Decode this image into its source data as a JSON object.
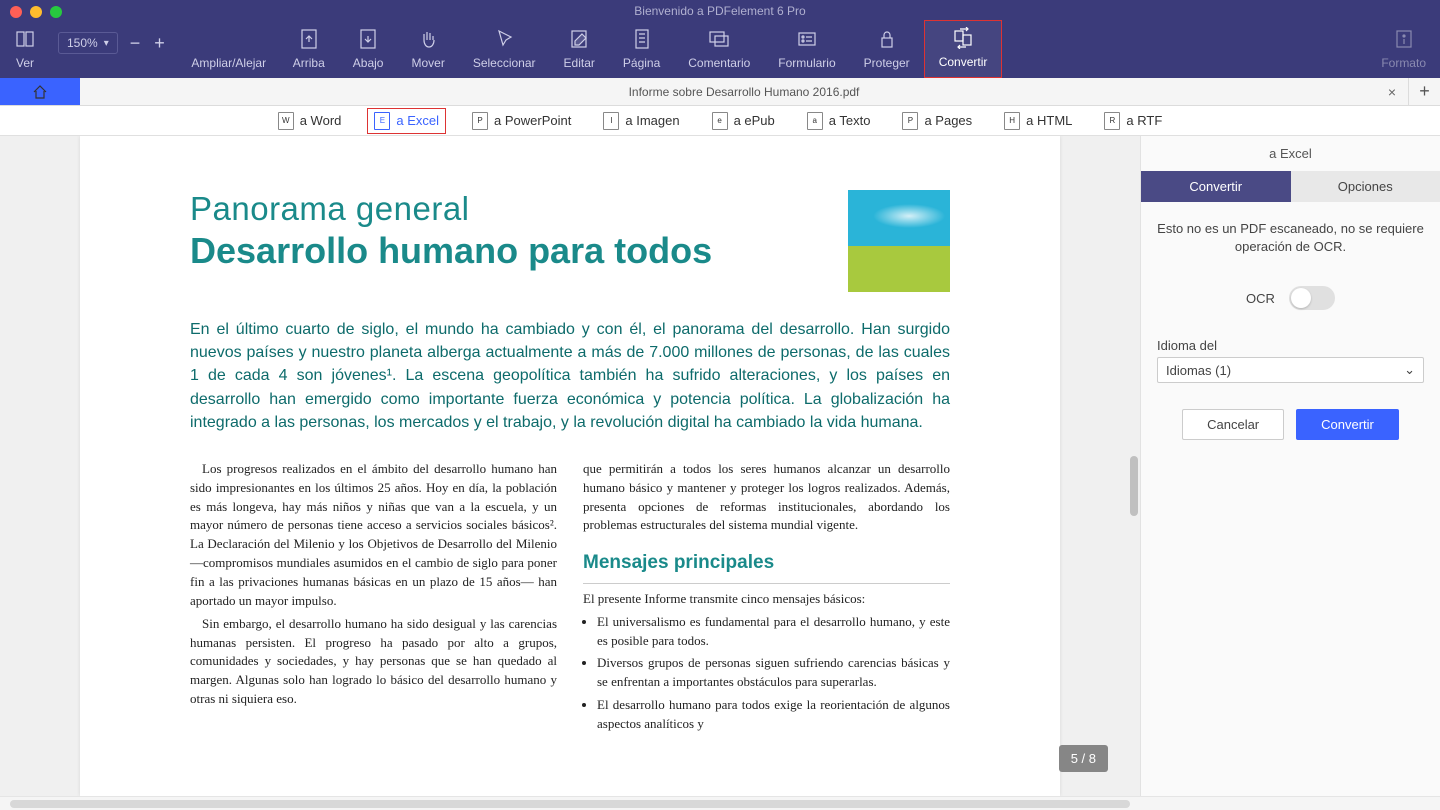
{
  "window_title": "Bienvenido a PDFelement 6 Pro",
  "zoom_value": "150%",
  "toolbar": {
    "ver": "Ver",
    "ampliar": "Ampliar/Alejar",
    "arriba": "Arriba",
    "abajo": "Abajo",
    "mover": "Mover",
    "seleccionar": "Seleccionar",
    "editar": "Editar",
    "pagina": "Página",
    "comentario": "Comentario",
    "formulario": "Formulario",
    "proteger": "Proteger",
    "convertir": "Convertir",
    "formato": "Formato"
  },
  "tab_title": "Informe sobre Desarrollo Humano 2016.pdf",
  "convert_formats": {
    "word": "a Word",
    "excel": "a Excel",
    "ppt": "a PowerPoint",
    "imagen": "a Imagen",
    "epub": "a ePub",
    "texto": "a Texto",
    "pages": "a Pages",
    "html": "a HTML",
    "rtf": "a RTF"
  },
  "page_content": {
    "title1": "Panorama general",
    "title2": "Desarrollo humano para todos",
    "intro": "En el último cuarto de siglo, el mundo ha cambiado y con él, el panorama del desarrollo. Han surgido nuevos países y nuestro planeta alberga actualmente a más de 7.000 millones de personas, de las cuales 1 de cada 4 son jóvenes¹. La escena geopolítica también ha sufrido alteraciones, y los países en desarrollo han emergido como importante fuerza económica y potencia política. La globalización ha integrado a las personas, los mercados y el trabajo, y la revolución digital ha cambiado la vida humana.",
    "col1a": "Los progresos realizados en el ámbito del desarrollo humano han sido impresionantes en los últimos 25 años. Hoy en día, la población es más longeva, hay más niños y niñas que van a la escuela, y un mayor número de personas tiene acceso a servicios sociales básicos². La Declaración del Milenio y los Objetivos de Desarrollo del Milenio —compromisos mundiales asumidos en el cambio de siglo para poner fin a las privaciones humanas básicas en un plazo de 15 años— han aportado un mayor impulso.",
    "col1b": "Sin embargo, el desarrollo humano ha sido desigual y las carencias humanas persisten. El progreso ha pasado por alto a grupos, comunidades y sociedades, y hay personas que se han quedado al margen. Algunas solo han logrado lo básico del desarrollo humano y otras ni siquiera eso.",
    "col2a": "que permitirán a todos los seres humanos alcanzar un desarrollo humano básico y mantener y proteger los logros realizados. Además, presenta opciones de reformas institucionales, abordando los problemas estructurales del sistema mundial vigente.",
    "col2h": "Mensajes principales",
    "col2b": "El presente Informe transmite cinco mensajes básicos:",
    "li1": "El universalismo es fundamental para el desarrollo humano, y este es posible para todos.",
    "li2": "Diversos grupos de personas siguen sufriendo carencias básicas y se enfrentan a importantes obstáculos para superarlas.",
    "li3": "El desarrollo humano para todos exige la reorientación de algunos aspectos analíticos y"
  },
  "page_indicator": "5 / 8",
  "panel": {
    "head": "a Excel",
    "tab_convertir": "Convertir",
    "tab_opciones": "Opciones",
    "message": "Esto no es un PDF escaneado, no se requiere operación de OCR.",
    "ocr_label": "OCR",
    "lang_label": "Idioma del",
    "lang_value": "Idiomas (1)",
    "btn_cancel": "Cancelar",
    "btn_convert": "Convertir"
  }
}
